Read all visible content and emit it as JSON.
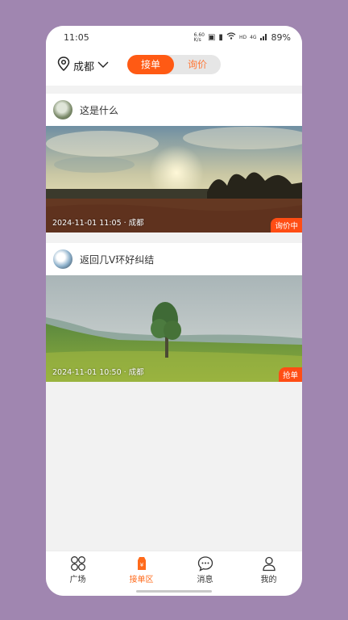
{
  "status": {
    "time": "11:05",
    "speed": "6.60\nK/s",
    "hd": "HD",
    "signal": "4G",
    "battery": "89%"
  },
  "header": {
    "location": "成都",
    "tabs": [
      {
        "label": "接单",
        "active": true
      },
      {
        "label": "询价",
        "active": false
      }
    ]
  },
  "posts": [
    {
      "title": "这是什么",
      "meta": "2024-11-01 11:05 · 成都",
      "badge": "询价中",
      "icon": "sunset-photo"
    },
    {
      "title": "返回几V环好纠结",
      "meta": "2024-11-01 10:50 · 成都",
      "badge": "抢单",
      "icon": "meadow-tree-photo"
    }
  ],
  "tabbar": [
    {
      "label": "广场",
      "icon": "grid-icon",
      "active": false
    },
    {
      "label": "接单区",
      "icon": "order-icon",
      "active": true
    },
    {
      "label": "消息",
      "icon": "message-icon",
      "active": false
    },
    {
      "label": "我的",
      "icon": "profile-icon",
      "active": false
    }
  ],
  "colors": {
    "accent": "#ff5a14",
    "background": "#a086b0"
  }
}
